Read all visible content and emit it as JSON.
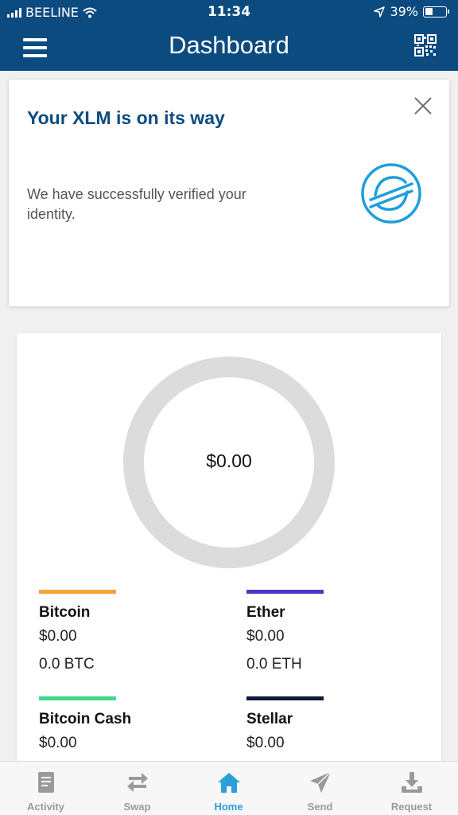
{
  "status_bar": {
    "carrier": "BEELINE",
    "time": "11:34",
    "battery": "39%",
    "battery_level": 0.39
  },
  "header": {
    "title": "Dashboard",
    "menu_icon": "hamburger-menu-icon",
    "qr_icon": "qr-code-icon"
  },
  "notice": {
    "title": "Your XLM is on its way",
    "body": "We have successfully verified your identity.",
    "close_icon": "close-icon",
    "logo_icon": "stellar-logo-icon"
  },
  "balances": {
    "total": "$0.00",
    "assets": [
      {
        "name": "Bitcoin",
        "fiat": "$0.00",
        "crypto": "0.0 BTC",
        "color": "#f6a23a"
      },
      {
        "name": "Ether",
        "fiat": "$0.00",
        "crypto": "0.0 ETH",
        "color": "#473ac7"
      },
      {
        "name": "Bitcoin Cash",
        "fiat": "$0.00",
        "crypto": "",
        "color": "#3fd88e"
      },
      {
        "name": "Stellar",
        "fiat": "$0.00",
        "crypto": "",
        "color": "#0f1b3c"
      }
    ]
  },
  "tabs": [
    {
      "label": "Activity",
      "icon": "activity-icon",
      "active": false
    },
    {
      "label": "Swap",
      "icon": "swap-icon",
      "active": false
    },
    {
      "label": "Home",
      "icon": "home-icon",
      "active": true
    },
    {
      "label": "Send",
      "icon": "send-icon",
      "active": false
    },
    {
      "label": "Request",
      "icon": "request-icon",
      "active": false
    }
  ],
  "colors": {
    "brand": "#0c4b80",
    "accent": "#2a9fd8",
    "donut_empty": "#dcdcdc"
  }
}
